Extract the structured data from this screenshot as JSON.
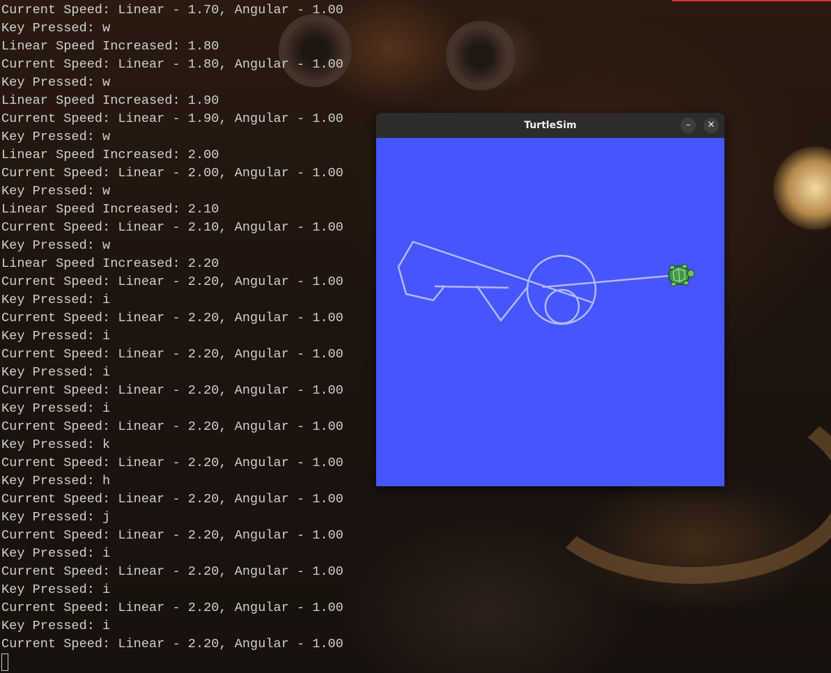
{
  "terminal": {
    "lines": [
      "Current Speed: Linear - 1.70, Angular - 1.00",
      "Key Pressed: w",
      "Linear Speed Increased: 1.80",
      "Current Speed: Linear - 1.80, Angular - 1.00",
      "Key Pressed: w",
      "Linear Speed Increased: 1.90",
      "Current Speed: Linear - 1.90, Angular - 1.00",
      "Key Pressed: w",
      "Linear Speed Increased: 2.00",
      "Current Speed: Linear - 2.00, Angular - 1.00",
      "Key Pressed: w",
      "Linear Speed Increased: 2.10",
      "Current Speed: Linear - 2.10, Angular - 1.00",
      "Key Pressed: w",
      "Linear Speed Increased: 2.20",
      "Current Speed: Linear - 2.20, Angular - 1.00",
      "Key Pressed: i",
      "Current Speed: Linear - 2.20, Angular - 1.00",
      "Key Pressed: i",
      "Current Speed: Linear - 2.20, Angular - 1.00",
      "Key Pressed: i",
      "Current Speed: Linear - 2.20, Angular - 1.00",
      "Key Pressed: i",
      "Current Speed: Linear - 2.20, Angular - 1.00",
      "Key Pressed: k",
      "Current Speed: Linear - 2.20, Angular - 1.00",
      "Key Pressed: h",
      "Current Speed: Linear - 2.20, Angular - 1.00",
      "Key Pressed: j",
      "Current Speed: Linear - 2.20, Angular - 1.00",
      "Key Pressed: i",
      "Current Speed: Linear - 2.20, Angular - 1.00",
      "Key Pressed: i",
      "Current Speed: Linear - 2.20, Angular - 1.00",
      "Key Pressed: i",
      "Current Speed: Linear - 2.20, Angular - 1.00"
    ]
  },
  "turtlesim": {
    "title": "TurtleSim",
    "minimize_icon": "minimize-icon",
    "close_icon": "close-icon",
    "background_color": "#4556ff",
    "pen_color": "#b3b8ff",
    "turtle_icon": "turtle-icon"
  }
}
